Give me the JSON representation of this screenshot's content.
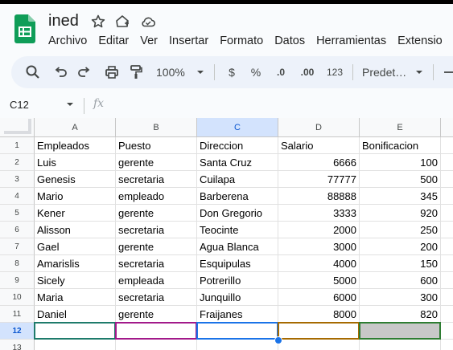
{
  "app": {
    "title": "ined",
    "icons": [
      "star-icon",
      "move-to-folder-icon",
      "cloud-status-icon"
    ]
  },
  "menu": [
    "Archivo",
    "Editar",
    "Ver",
    "Insertar",
    "Formato",
    "Datos",
    "Herramientas",
    "Extensio"
  ],
  "toolbar": {
    "zoom": "100%",
    "currency": "$",
    "percent": "%",
    "decrease_decimals": ".0",
    "increase_decimals": ".00",
    "number_format": "123",
    "font": "Predet…",
    "icons": [
      "search-icon",
      "undo-icon",
      "redo-icon",
      "print-icon",
      "paint-format-icon"
    ]
  },
  "formula_bar": {
    "cell_ref": "C12",
    "fx": "fx",
    "content": ""
  },
  "sheet": {
    "columns": [
      "A",
      "B",
      "C",
      "D",
      "E"
    ],
    "selected_column": "C",
    "selected_row": "12",
    "row_numbers": [
      "1",
      "2",
      "3",
      "4",
      "5",
      "6",
      "7",
      "8",
      "9",
      "10",
      "11",
      "12",
      "13"
    ],
    "rows": [
      [
        "Empleados",
        "Puesto",
        "Direccion",
        "Salario",
        "Bonificacion"
      ],
      [
        "Luis",
        "gerente",
        "Santa Cruz",
        "6666",
        "100"
      ],
      [
        "Genesis",
        "secretaria",
        "Cuilapa",
        "77777",
        "500"
      ],
      [
        "Mario",
        "empleado",
        "Barberena",
        "88888",
        "345"
      ],
      [
        "Kener",
        "gerente",
        "Don Gregorio",
        "3333",
        "920"
      ],
      [
        "Alisson",
        "secretaria",
        "Teocinte",
        "2000",
        "250"
      ],
      [
        "Gael",
        "gerente",
        "Agua Blanca",
        "3000",
        "200"
      ],
      [
        "Amarislis",
        "secretaria",
        "Esquipulas",
        "4000",
        "150"
      ],
      [
        "Sicely",
        "empleada",
        "Potrerillo",
        "5000",
        "600"
      ],
      [
        "Maria",
        "secretaria",
        "Junquillo",
        "6000",
        "300"
      ],
      [
        "Daniel",
        "gerente",
        "Fraijanes",
        "8000",
        "820"
      ],
      [
        "",
        "",
        "",
        "",
        ""
      ],
      [
        "",
        "",
        "",
        "",
        ""
      ]
    ],
    "row12_border_colors": [
      "#1e7b6b",
      "#a2198a",
      "#1a73e8",
      "#a66a00",
      "#2e7d32"
    ],
    "row12_e_fill": "#c8c8c8"
  }
}
